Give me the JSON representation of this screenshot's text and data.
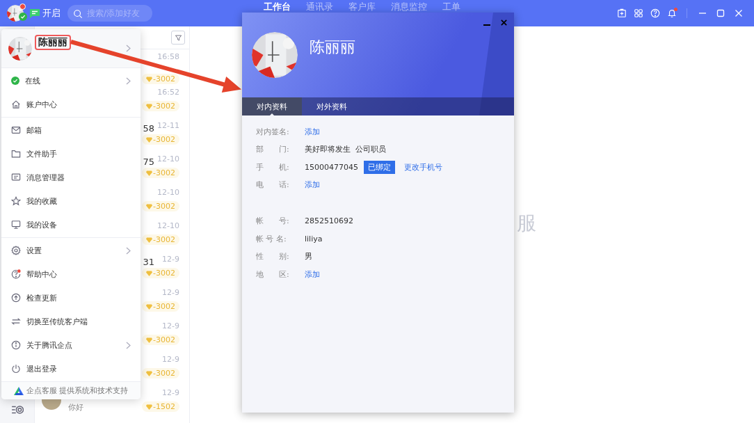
{
  "topbar": {
    "status_label": "开启",
    "search": {
      "placeholder": "搜索/添加好友"
    },
    "nav": [
      {
        "label": "工作台",
        "selected": true
      },
      {
        "label": "通讯录",
        "selected": false
      },
      {
        "label": "客户库",
        "selected": false
      },
      {
        "label": "消息监控",
        "selected": false
      },
      {
        "label": "工单",
        "selected": false
      }
    ]
  },
  "conversations": [
    {
      "time": "16:58",
      "badge": "-3002"
    },
    {
      "time": "16:52",
      "badge": "-3002"
    },
    {
      "name": "58",
      "time": "12-11",
      "badge": "-3002"
    },
    {
      "name": "75",
      "time": "12-10",
      "badge": "-3002"
    },
    {
      "time": "12-10",
      "badge": "-3002"
    },
    {
      "time": "12-10",
      "badge": "-3002"
    },
    {
      "name": "31",
      "time": "12-9",
      "badge": "-3002"
    },
    {
      "time": "12-9",
      "badge": "-3002"
    },
    {
      "time": "12-9",
      "badge": "-3002"
    },
    {
      "time": "12-9",
      "badge": "-3002"
    },
    {
      "time": "12-9",
      "badge": "-1502",
      "preview": "你好"
    }
  ],
  "main_watermark": "服",
  "menu": {
    "user": {
      "name": "陈丽丽",
      "highlighted": true
    },
    "groups": [
      [
        {
          "label": "在线",
          "submenu": true
        },
        {
          "label": "账户中心",
          "submenu": false
        }
      ],
      [
        {
          "label": "邮箱",
          "submenu": false
        },
        {
          "label": "文件助手",
          "submenu": false
        },
        {
          "label": "消息管理器",
          "submenu": false
        },
        {
          "label": "我的收藏",
          "submenu": false
        },
        {
          "label": "我的设备",
          "submenu": false
        }
      ],
      [
        {
          "label": "设置",
          "submenu": true
        },
        {
          "label": "帮助中心",
          "submenu": false
        },
        {
          "label": "检查更新",
          "submenu": false
        },
        {
          "label": "切换至传统客户端",
          "submenu": false
        },
        {
          "label": "关于腾讯企点",
          "submenu": true
        },
        {
          "label": "退出登录",
          "submenu": false
        }
      ]
    ],
    "footer": "企点客服 提供系统和技术支持"
  },
  "profile": {
    "name": "陈丽丽",
    "tabs": [
      {
        "label": "对内资料",
        "selected": true
      },
      {
        "label": "对外资料",
        "selected": false
      }
    ],
    "groups": [
      [
        {
          "label": "对内签名:",
          "kind": "link",
          "value": "添加"
        },
        {
          "label": "部　　门:",
          "kind": "text",
          "value": "美好即将发生  公司职员"
        },
        {
          "label": "手　　机:",
          "kind": "phone",
          "value": "15000477045",
          "tag": "已绑定",
          "action": "更改手机号"
        },
        {
          "label": "电　　话:",
          "kind": "link",
          "value": "添加"
        }
      ],
      [
        {
          "label": "帐　　号:",
          "kind": "text",
          "value": "2852510692"
        },
        {
          "label": "帐 号 名:",
          "kind": "text",
          "value": "liliya"
        },
        {
          "label": "性　　别:",
          "kind": "text",
          "value": "男"
        },
        {
          "label": "地　　区:",
          "kind": "link",
          "value": "添加"
        }
      ]
    ]
  }
}
